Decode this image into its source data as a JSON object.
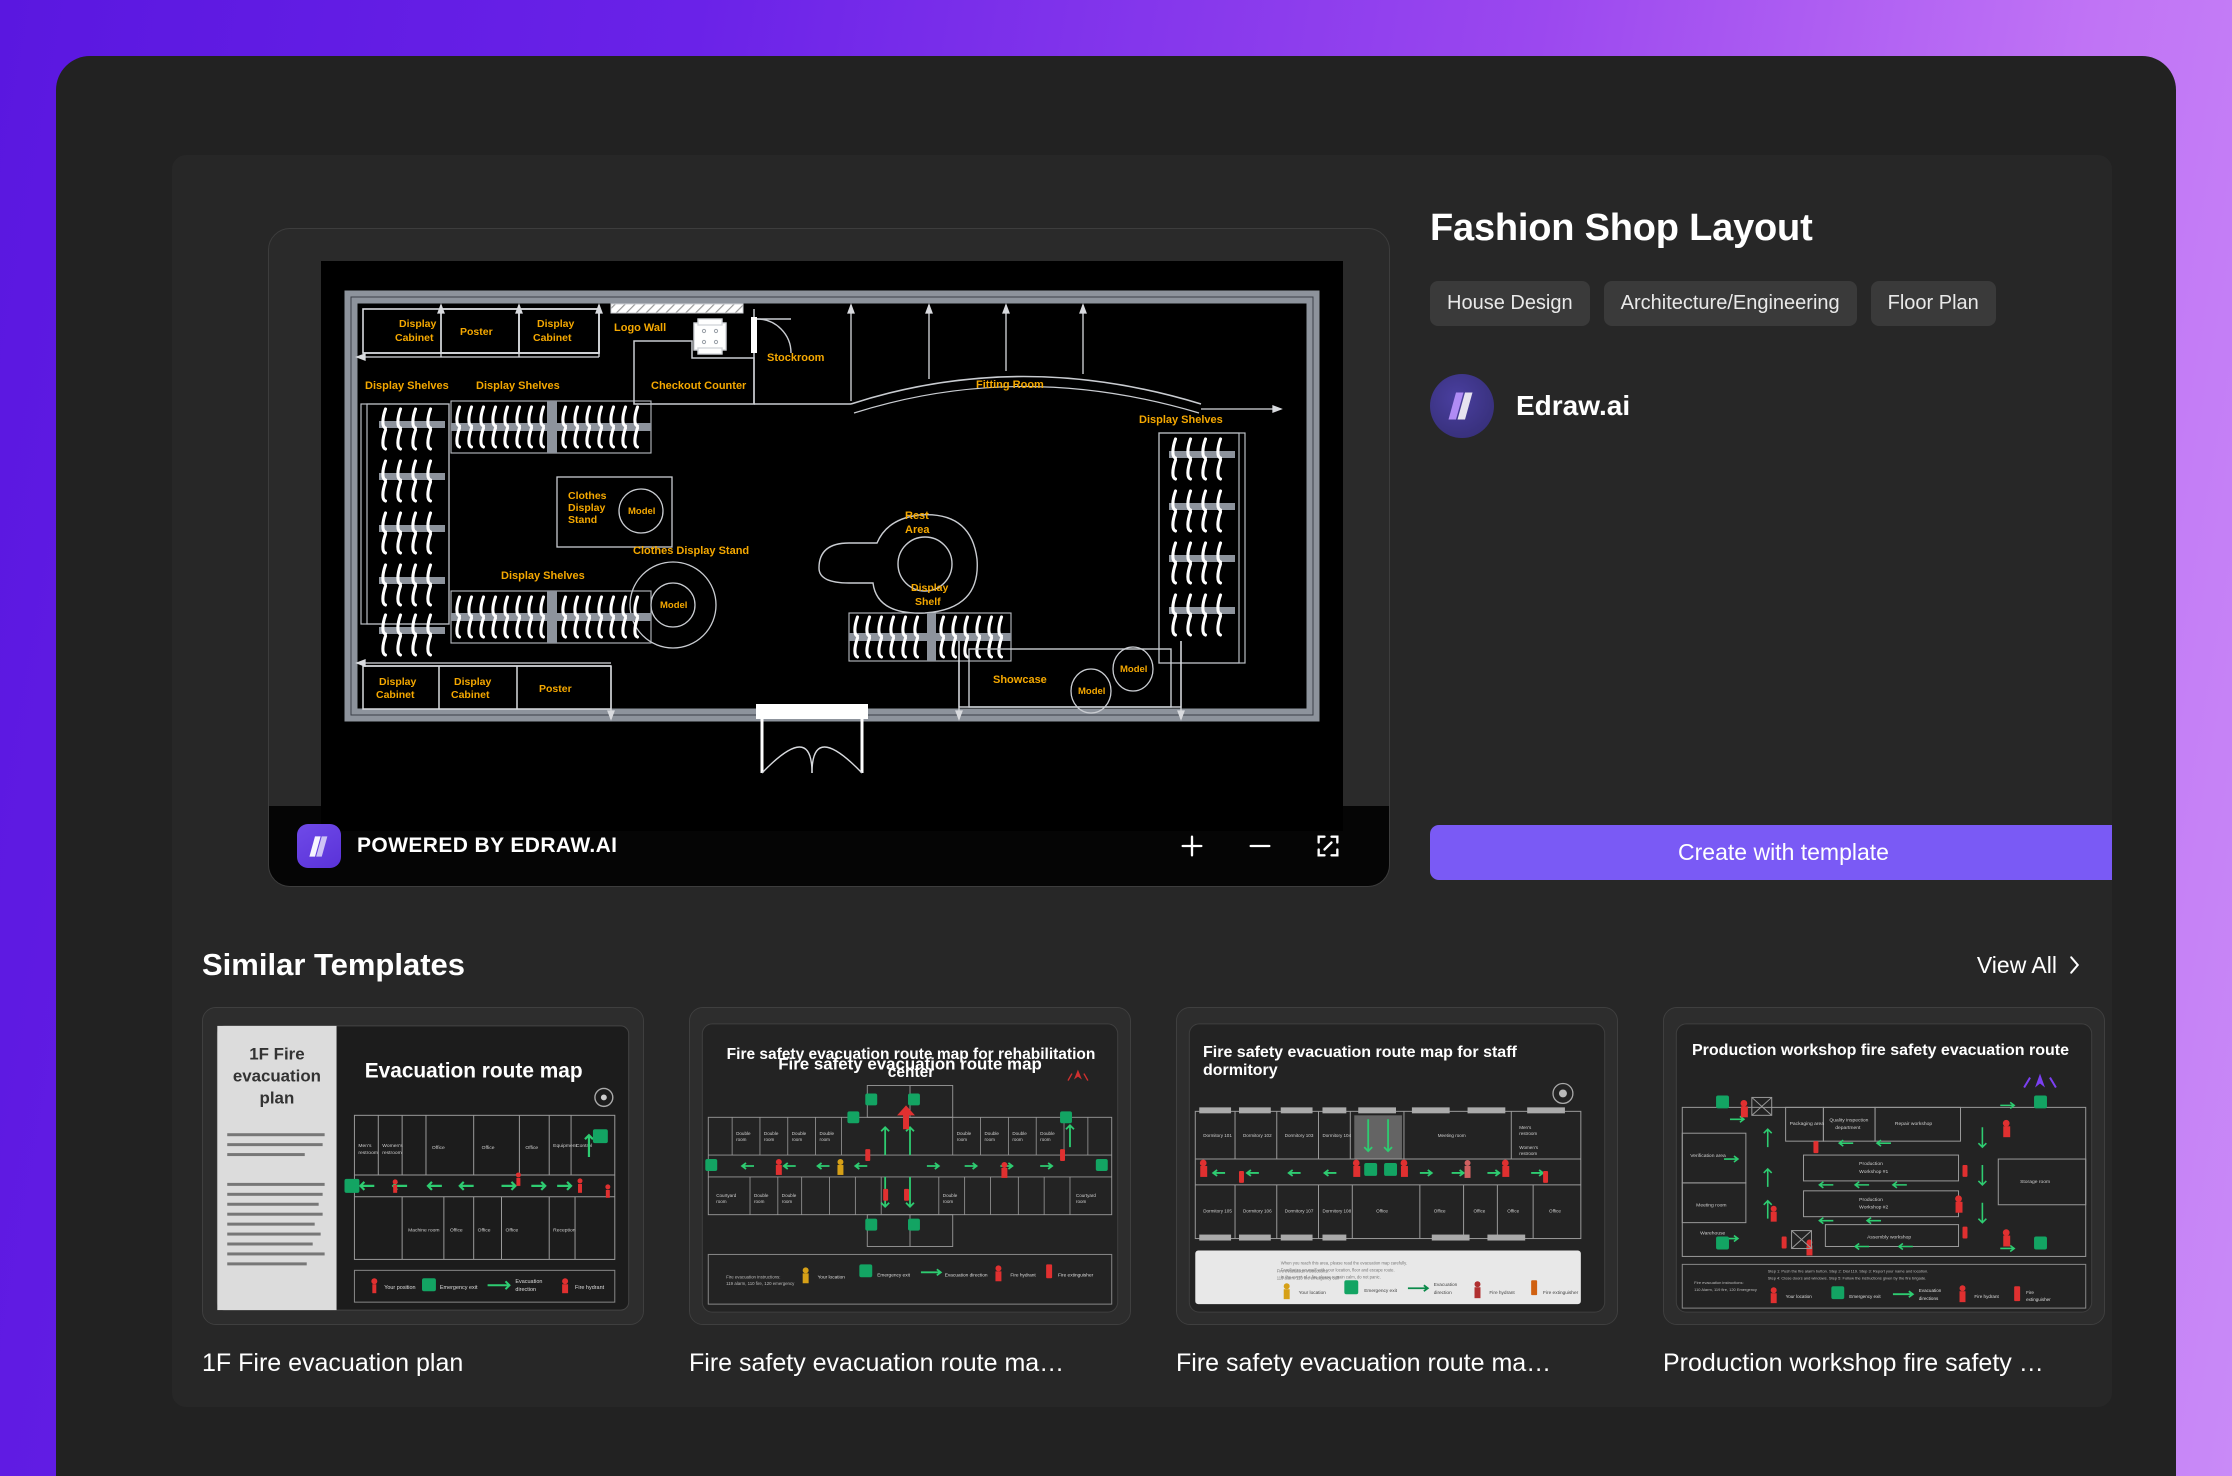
{
  "theme": {
    "frame_gradient_from": "#5a17e0",
    "frame_gradient_to": "#c98af7",
    "panel_bg": "#272727",
    "accent": "#7a5af5",
    "label_gold": "#f5a800"
  },
  "preview": {
    "powered_by": "POWERED BY EDRAW.AI",
    "zoom_in_icon": "plus-icon",
    "zoom_out_icon": "minus-icon",
    "fullscreen_icon": "fullscreen-icon",
    "brand_icon": "edraw-logo-icon"
  },
  "detail": {
    "title": "Fashion Shop Layout",
    "tags": [
      "House Design",
      "Architecture/Engineering",
      "Floor Plan"
    ],
    "author": "Edraw.ai",
    "author_avatar_icon": "edraw-avatar-icon",
    "create_button": "Create with template"
  },
  "similar": {
    "heading": "Similar Templates",
    "view_all": "View All",
    "view_all_icon": "chevron-right-icon",
    "cards": [
      {
        "title": "1F Fire evacuation plan",
        "thumb_heading": "1F Fire\nevacuation\nplan",
        "thumb_map_title": "Evacuation route map"
      },
      {
        "title": "Fire safety evacuation route ma…",
        "thumb_map_title": "Fire safety evacuation route map for rehabilitation center"
      },
      {
        "title": "Fire safety evacuation route ma…",
        "thumb_map_title": "Fire safety evacuation route map for staff dormitory"
      },
      {
        "title": "Production workshop fire safety …",
        "thumb_map_title": "Production workshop fire safety evacuation route"
      }
    ]
  },
  "floorplan": {
    "labels": [
      "Display Cabinet",
      "Poster",
      "Display Cabinet",
      "Logo Wall",
      "Checkout Counter",
      "Stockroom",
      "Fitting Room",
      "Display Shelves",
      "Display Shelves",
      "Display Shelves",
      "Clothes Display Stand",
      "Model",
      "Clothes Display Stand",
      "Model",
      "Rest Area",
      "Display Shelf",
      "Display Shelves",
      "Display Cabinet",
      "Display Cabinet",
      "Poster",
      "Showcase",
      "Model",
      "Model"
    ]
  }
}
